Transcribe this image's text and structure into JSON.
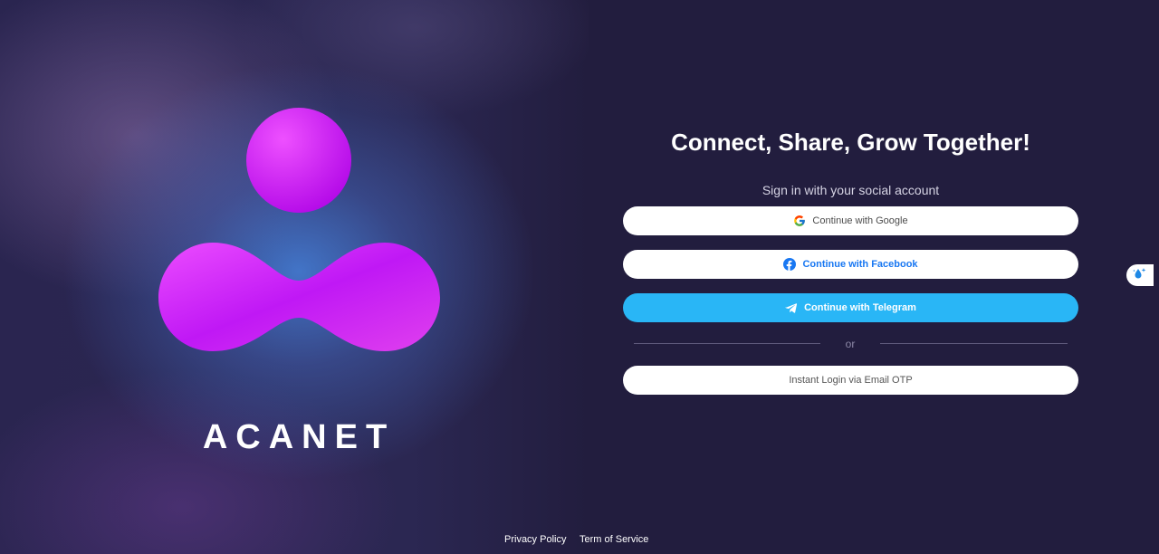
{
  "brand": {
    "name": "ACANET",
    "colors": {
      "logo_start": "#ee50ff",
      "logo_end": "#b010f2",
      "background": "#221d3e"
    }
  },
  "login": {
    "headline": "Connect, Share, Grow Together!",
    "subtitle": "Sign in with your social account",
    "google_label": "Continue with Google",
    "facebook_label": "Continue with Facebook",
    "telegram_label": "Continue with Telegram",
    "divider_text": "or",
    "email_label": "Instant Login via Email OTP",
    "colors": {
      "telegram": "#29b6f6",
      "facebook": "#1877f2"
    }
  },
  "footer": {
    "privacy_label": "Privacy Policy",
    "terms_label": "Term of Service"
  },
  "icons": [
    "google-icon",
    "facebook-icon",
    "telegram-icon",
    "accessibility-widget-icon"
  ]
}
